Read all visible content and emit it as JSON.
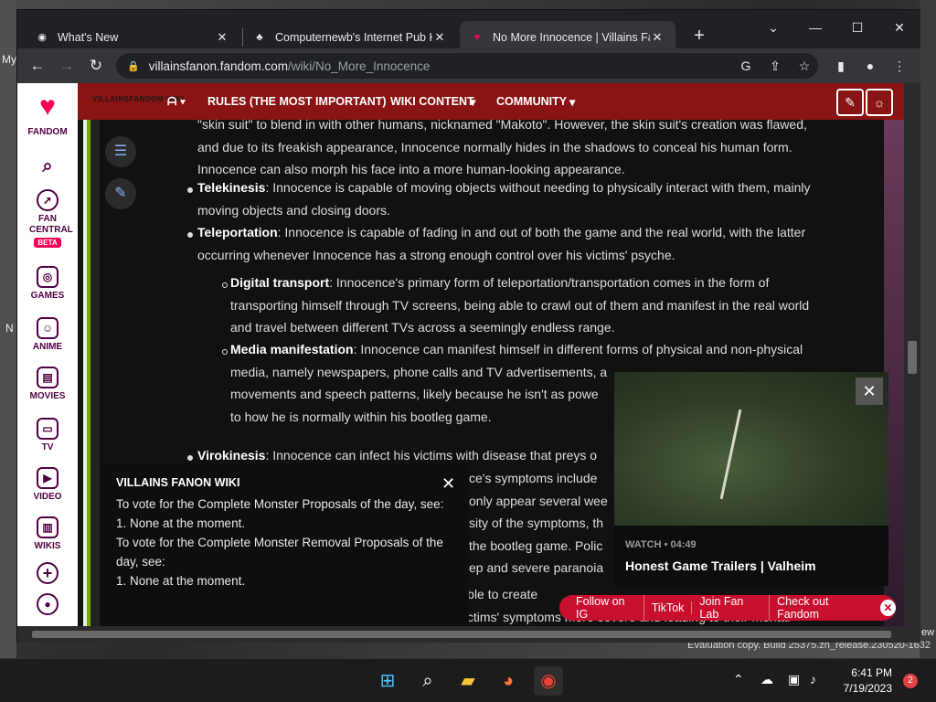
{
  "desktop": {
    "left_text_1": "My",
    "left_text_2": "N",
    "right_text": "ew",
    "evaluation": "Evaluation copy. Build 25375.zn_release.230520-1632"
  },
  "browser": {
    "tabs": [
      {
        "title": "What's New",
        "icon": "chrome-icon"
      },
      {
        "title": "Computernewb's Internet Pub H",
        "icon": "pub-icon"
      },
      {
        "title": "No More Innocence | Villains Fan",
        "icon": "fandom-icon"
      }
    ],
    "url_host": "villainsfanon.fandom.com",
    "url_path": "/wiki/No_More_Innocence"
  },
  "fandom_rail": {
    "brand": "FANDOM",
    "fan_central": "FAN CENTRAL",
    "beta": "BETA",
    "games": "GAMES",
    "anime": "ANIME",
    "movies": "MOVIES",
    "tv": "TV",
    "video": "VIDEO",
    "wikis": "WIKIS"
  },
  "wiki_nav": {
    "logo_text": "VILLAINSFANDOM WIKI",
    "rules": "RULES (THE MOST IMPORTANT)",
    "wiki_content": "WIKI CONTENT",
    "community": "COMMUNITY"
  },
  "article": {
    "para0_line1": "\"skin suit\" to blend in with other humans, nicknamed \"Makoto\". However, the skin suit's creation was flawed,",
    "para0_line2": "and due to its freakish appearance, Innocence normally hides in the shadows to conceal his human form.",
    "para0_line3": "Innocence can also morph his face into a more human-looking appearance.",
    "telekinesis_term": "Telekinesis",
    "telekinesis_line1": ": Innocence is capable of moving objects without needing to physically interact with them, mainly",
    "telekinesis_line2": "moving objects and closing doors.",
    "teleportation_term": "Teleportation",
    "teleportation_line1": ": Innocence is capable of fading in and out of both the game and the real world, with the latter",
    "teleportation_line2": "occurring whenever Innocence has a strong enough control over his victims' psyche.",
    "digital_term": "Digital transport",
    "digital_line1": ": Innocence's primary form of teleportation/transportation comes in the form of",
    "digital_line2": "transporting himself through TV screens, being able to crawl out of them and manifest in the real world",
    "digital_line3": "and travel between different TVs across a seemingly endless range.",
    "media_term": "Media manifestation",
    "media_line1": ": Innocence can manifest himself in different forms of physical and non-physical",
    "media_line2": "media, namely newspapers, phone calls and TV advertisements, a",
    "media_line3": "movements and speech patterns, likely because he isn't as powe",
    "media_line4": "to how he is normally within his bootleg game.",
    "viro_term": "Virokinesis",
    "viro_line1": ": Innocence can infect his victims with disease that preys o",
    "frag1": "ce's symptoms include",
    "frag2": "only appear several wee",
    "frag3": "sity of the symptoms, th",
    "frag4": "the bootleg game. Polic",
    "frag5": "ep and severe paranoia",
    "disease_line": "Disease augmentation: As well as being able to create",
    "last_line": "enhance their effectiveness, making his victims' symptoms more severe and leading to their mental"
  },
  "notice": {
    "title": "VILLAINS FANON WIKI",
    "line1": "To vote for the Complete Monster Proposals of the day, see:",
    "line2": "1. None at the moment.",
    "line3": "To vote for the Complete Monster Removal Proposals of the",
    "line4": "day, see:",
    "line5": "1. None at the moment."
  },
  "video": {
    "meta": "WATCH • 04:49",
    "title": "Honest Game Trailers | Valheim"
  },
  "follow_bar": {
    "ig": "Follow on IG",
    "tiktok": "TikTok",
    "fanlab": "Join Fan Lab",
    "fandom": "Check out Fandom"
  },
  "taskbar": {
    "time": "6:41 PM",
    "date": "7/19/2023",
    "badge": "2"
  },
  "colors": {
    "accent": "#8a1414",
    "fandom_pink": "#fa005a",
    "follow_bar": "#c8102e"
  }
}
